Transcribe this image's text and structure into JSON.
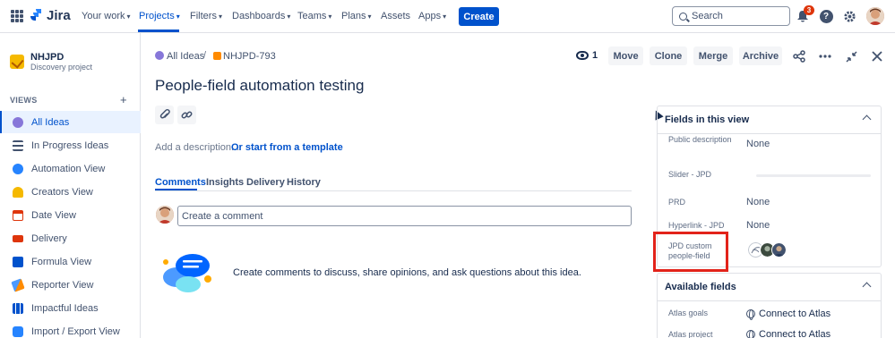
{
  "topnav": {
    "product": "Jira",
    "items": [
      {
        "label": "Your work",
        "chevron": true
      },
      {
        "label": "Projects",
        "chevron": true,
        "active": true
      },
      {
        "label": "Filters",
        "chevron": true
      },
      {
        "label": "Dashboards",
        "chevron": true
      },
      {
        "label": "Teams",
        "chevron": true
      },
      {
        "label": "Plans",
        "chevron": true
      },
      {
        "label": "Assets",
        "chevron": false
      },
      {
        "label": "Apps",
        "chevron": true
      }
    ],
    "create_label": "Create",
    "search_placeholder": "Search",
    "notification_count": "3",
    "accent": "#0052cc"
  },
  "sidebar": {
    "project_name": "NHJPD",
    "project_type": "Discovery project",
    "views_heading": "VIEWS",
    "add_icon": "+",
    "items": [
      {
        "label": "All Ideas",
        "icon": "ideas-icon",
        "active": true
      },
      {
        "label": "In Progress Ideas",
        "icon": "timeline-icon"
      },
      {
        "label": "Automation View",
        "icon": "infinity-icon"
      },
      {
        "label": "Creators View",
        "icon": "person-icon"
      },
      {
        "label": "Date View",
        "icon": "calendar-icon"
      },
      {
        "label": "Delivery",
        "icon": "truck-icon"
      },
      {
        "label": "Formula View",
        "icon": "calculator-icon"
      },
      {
        "label": "Reporter View",
        "icon": "pen-icon"
      },
      {
        "label": "Impactful Ideas",
        "icon": "chart-icon"
      },
      {
        "label": "Import / Export View",
        "icon": "import-export-icon"
      }
    ]
  },
  "breadcrumb": {
    "root": "All Ideas",
    "separator": "/",
    "issue_key": "NHJPD-793"
  },
  "header_actions": {
    "watchers": "1",
    "move": "Move",
    "clone": "Clone",
    "merge": "Merge",
    "archive": "Archive"
  },
  "issue": {
    "title": "People-field automation testing",
    "description_placeholder": "Add a description...",
    "template_link": "Or start from a template"
  },
  "tabs": [
    "Comments",
    "Insights",
    "Delivery",
    "History"
  ],
  "comments": {
    "input_placeholder": "Create a comment",
    "empty_message": "Create comments to discuss, share opinions, and ask questions about this idea."
  },
  "fields_panel": {
    "heading": "Fields in this view",
    "fields": [
      {
        "label": "Public description",
        "value": "None"
      },
      {
        "label": "Slider - JPD",
        "value": ""
      },
      {
        "label": "PRD",
        "value": "None"
      },
      {
        "label": "Hyperlink - JPD",
        "value": "None"
      },
      {
        "label": "JPD custom people-field",
        "value": ""
      }
    ]
  },
  "available_panel": {
    "heading": "Available fields",
    "fields": [
      {
        "label": "Atlas goals",
        "value": "Connect to Atlas"
      },
      {
        "label": "Atlas project",
        "value": "Connect to Atlas"
      }
    ]
  }
}
